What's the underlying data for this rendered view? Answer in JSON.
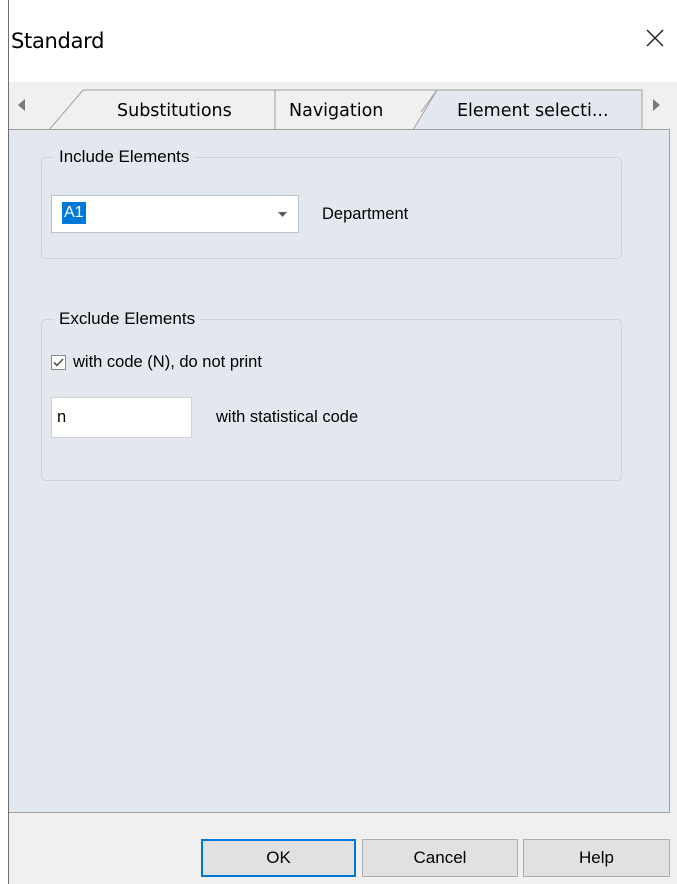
{
  "window": {
    "title": "Standard"
  },
  "tabs": [
    {
      "label": "Substitutions",
      "active": false
    },
    {
      "label": "Navigation",
      "active": false
    },
    {
      "label": "Element selecti...",
      "active": true
    }
  ],
  "include_group": {
    "legend": "Include Elements",
    "combo_value": "A1",
    "combo_label": "Department"
  },
  "exclude_group": {
    "legend": "Exclude Elements",
    "checkbox_label": "with code (N), do not print",
    "checkbox_checked": true,
    "stat_code_value": "n",
    "stat_code_label": "with statistical code"
  },
  "footer": {
    "ok_label": "OK",
    "cancel_label": "Cancel",
    "help_label": "Help"
  },
  "icons": [
    "close-icon",
    "scroll-left-icon",
    "scroll-right-icon",
    "dropdown-arrow-icon",
    "checkmark-icon"
  ]
}
